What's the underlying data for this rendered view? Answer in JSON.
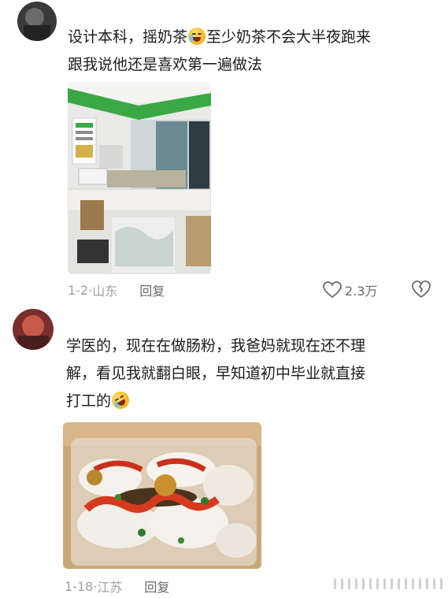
{
  "comments": [
    {
      "text_line1_a": "设计本科，摇奶茶",
      "text_line1_b": "至少奶茶不会大半夜跑来",
      "text_line2": "跟我说他还是喜欢第一遍做法",
      "emoji": "crying-face-icon",
      "date": "1-2",
      "location": "山东",
      "reply_label": "回复",
      "like_count": "2.3万"
    },
    {
      "text_line1": "学医的，现在在做肠粉，我爸妈就现在还不理",
      "text_line2": "解，看见我就翻白眼，早知道初中毕业就直接",
      "text_line3": "打工的",
      "emoji": "rolling-laughing-icon",
      "date": "1-18",
      "location": "江苏",
      "reply_label": "回复"
    }
  ],
  "colors": {
    "meta_text": "#a0a0a5",
    "body_text": "#1c1c1c",
    "store_green": "#39a845"
  }
}
